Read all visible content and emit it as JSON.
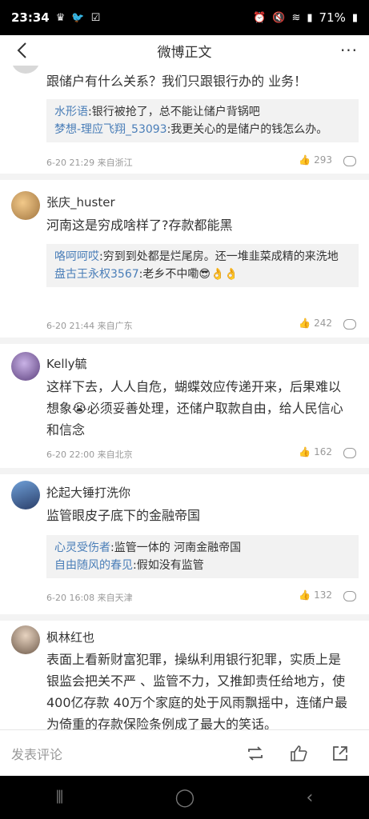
{
  "status_bar": {
    "time": "23:34",
    "battery": "71%"
  },
  "nav": {
    "title": "微博正文"
  },
  "comments": [
    {
      "text": "跟储户有什么关系？我们只跟银行办的 业务！",
      "replies": [
        {
          "name": "水形语",
          "text": ":银行被抢了，总不能让储户背锅吧"
        },
        {
          "name": "梦想-理应飞翔_53093",
          "text": ":我更关心的是储户的钱怎么办。"
        }
      ],
      "time": "6-20 21:29 来自浙江",
      "likes": "293"
    },
    {
      "username": "张庆_huster",
      "text": "河南这是穷成啥样了?存款都能黑",
      "replies": [
        {
          "name": "咯呵呵哎",
          "text": ":穷到到处都是烂尾房。还一堆韭菜成精的来洗地"
        },
        {
          "name": "盘古王永权3567",
          "text": ":老乡不中嘞😎👌👌"
        }
      ],
      "time": "6-20 21:44 来自广东",
      "likes": "242"
    },
    {
      "username": "Kelly毓",
      "text": "这样下去，人人自危，蝴蝶效应传递开来，后果难以想象😭必须妥善处理，还储户取款自由，给人民信心和信念",
      "time": "6-20 22:00 来自北京",
      "likes": "162"
    },
    {
      "username": "抡起大锤打洗你",
      "text": "监管眼皮子底下的金融帝国",
      "replies": [
        {
          "name": "心灵受伤者",
          "text": ":监管一体的 河南金融帝国"
        },
        {
          "name": "自由随风的春见",
          "text": ":假如没有监管"
        }
      ],
      "time": "6-20 16:08 来自天津",
      "likes": "132"
    },
    {
      "username": "枫林红也",
      "text": "表面上看新财富犯罪，操纵利用银行犯罪，实质上是银监会把关不严 、监管不力，又推卸责任给地方，使400亿存款 40万个家庭的处于风雨飘摇中，连储户最为倚重的存款保险条例成了最大的笑话。"
    }
  ],
  "bottom_bar": {
    "placeholder": "发表评论"
  }
}
